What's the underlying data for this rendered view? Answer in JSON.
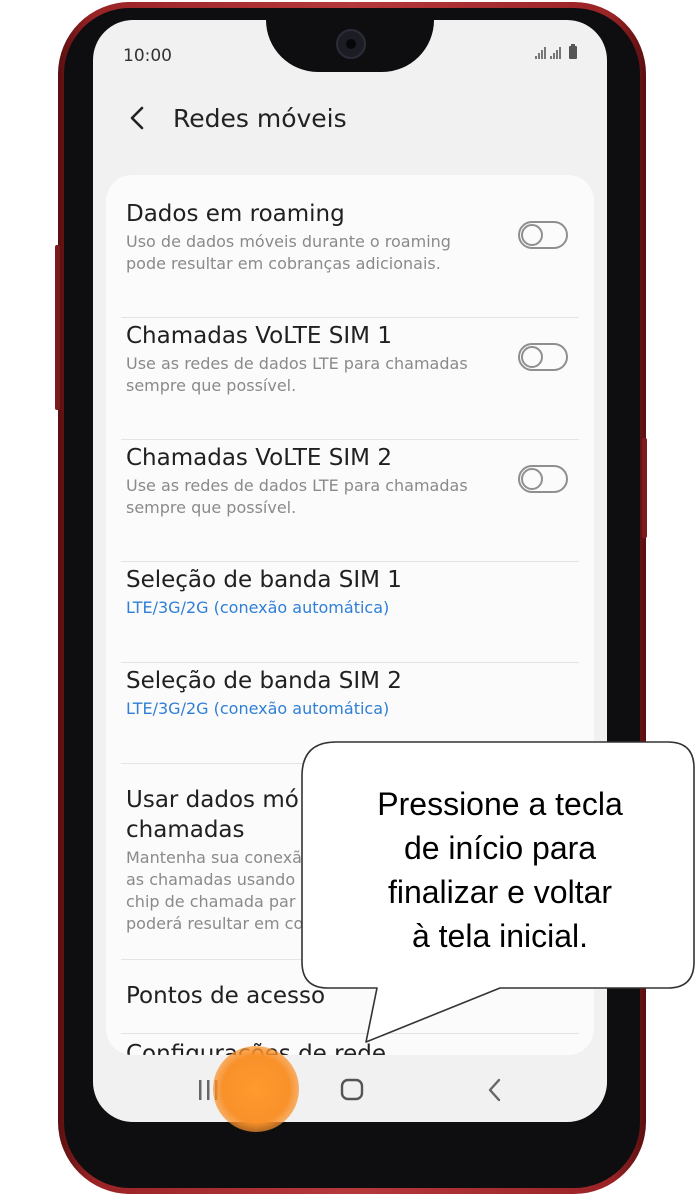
{
  "status_bar": {
    "time": "10:00"
  },
  "header": {
    "title": "Redes móveis"
  },
  "settings": [
    {
      "title": "Dados em roaming",
      "subtitle": "Uso de dados móveis durante o roaming pode resultar em cobranças adicionais.",
      "toggle": false
    },
    {
      "title": "Chamadas VoLTE SIM 1",
      "subtitle": "Use as redes de dados LTE para chamadas sempre que possível.",
      "toggle": false
    },
    {
      "title": "Chamadas VoLTE SIM 2",
      "subtitle": "Use as redes de dados LTE para chamadas sempre que possível.",
      "toggle": false
    },
    {
      "title": "Seleção de banda SIM 1",
      "subtitle": "LTE/3G/2G (conexão automática)"
    },
    {
      "title": "Seleção de banda SIM 2",
      "subtitle": "LTE/3G/2G (conexão automática)"
    },
    {
      "title_line1": "Usar dados mó",
      "title_line2": "chamadas",
      "sub_line1": "Mantenha sua conexã",
      "sub_line2": "as chamadas usando",
      "sub_line3": "chip de chamada par",
      "sub_line4": "poderá resultar em co"
    },
    {
      "title": "Pontos de acesso"
    },
    {
      "title": "Configurações de rede"
    }
  ],
  "navbar": {
    "recent_icon": "recent-apps-icon",
    "home_icon": "home-icon",
    "back_icon": "back-icon"
  },
  "callout": {
    "line1": "Pressione a tecla",
    "line2": "de início para",
    "line3": "finalizar e voltar",
    "line4": "à tela inicial."
  },
  "colors": {
    "accent": "#2f7fd6",
    "highlight": "#f9912a",
    "phone_frame": "#b5393b"
  }
}
